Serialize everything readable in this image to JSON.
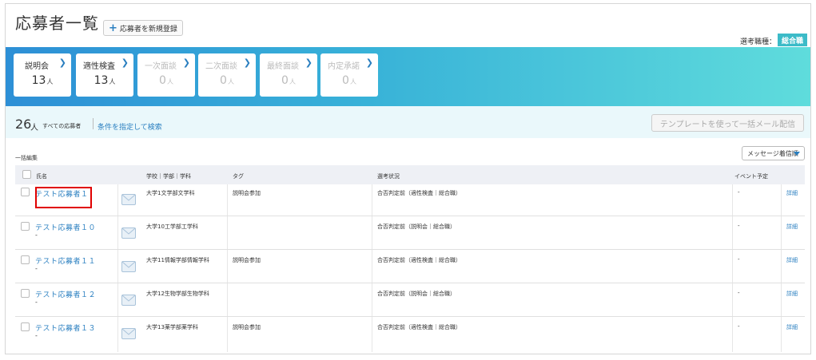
{
  "header": {
    "title": "応募者一覧",
    "add_button_label": "応募者を新規登録",
    "job_type_label": "選考職種：",
    "job_type_value": "総合職"
  },
  "stages": [
    {
      "label": "説明会",
      "count": "13",
      "unit": "人"
    },
    {
      "label": "適性検査",
      "count": "13",
      "unit": "人"
    },
    {
      "label": "一次面談",
      "count": "0",
      "unit": "人"
    },
    {
      "label": "二次面談",
      "count": "0",
      "unit": "人"
    },
    {
      "label": "最終面談",
      "count": "0",
      "unit": "人"
    },
    {
      "label": "内定承諾",
      "count": "0",
      "unit": "人"
    }
  ],
  "summary": {
    "total": "26",
    "unit": "人",
    "total_label": "すべての応募者",
    "search_link": "条件を指定して検索",
    "mail_button": "テンプレートを使って一括メール配信"
  },
  "bulk_edit_label": "一括編集",
  "sort_select": "メッセージ着信順",
  "table": {
    "headers": {
      "name": "氏名",
      "school": "学校｜学部｜学科",
      "tag": "タグ",
      "status": "選考状況",
      "event": "イベント予定"
    },
    "rows": [
      {
        "name": "テスト応募者１",
        "sub": "",
        "school": "大学1文学部文学科",
        "tag": "説明会参加",
        "status": "合否判定前（適性検査｜総合職）",
        "event": "-",
        "detail": "詳細"
      },
      {
        "name": "テスト応募者１０",
        "sub": "-",
        "school": "大学10工学部工学科",
        "tag": "",
        "status": "合否判定前（説明会｜総合職）",
        "event": "-",
        "detail": "詳細"
      },
      {
        "name": "テスト応募者１１",
        "sub": "-",
        "school": "大学11情報学部情報学科",
        "tag": "説明会参加",
        "status": "合否判定前（適性検査｜総合職）",
        "event": "-",
        "detail": "詳細"
      },
      {
        "name": "テスト応募者１２",
        "sub": "-",
        "school": "大学12生物学部生物学科",
        "tag": "",
        "status": "合否判定前（説明会｜総合職）",
        "event": "-",
        "detail": "詳細"
      },
      {
        "name": "テスト応募者１３",
        "sub": "-",
        "school": "大学13薬学部薬学科",
        "tag": "説明会参加",
        "status": "合否判定前（適性検査｜総合職）",
        "event": "-",
        "detail": "詳細"
      }
    ]
  },
  "colors": {
    "accent": "#2a7fc0",
    "band_start": "#2d8fd6",
    "band_end": "#5fdcdc",
    "badge": "#3cbbc8",
    "highlight": "#e00000"
  },
  "icons": [
    "plus-icon",
    "chevron-right-icon",
    "caret-down-icon",
    "envelope-icon"
  ]
}
